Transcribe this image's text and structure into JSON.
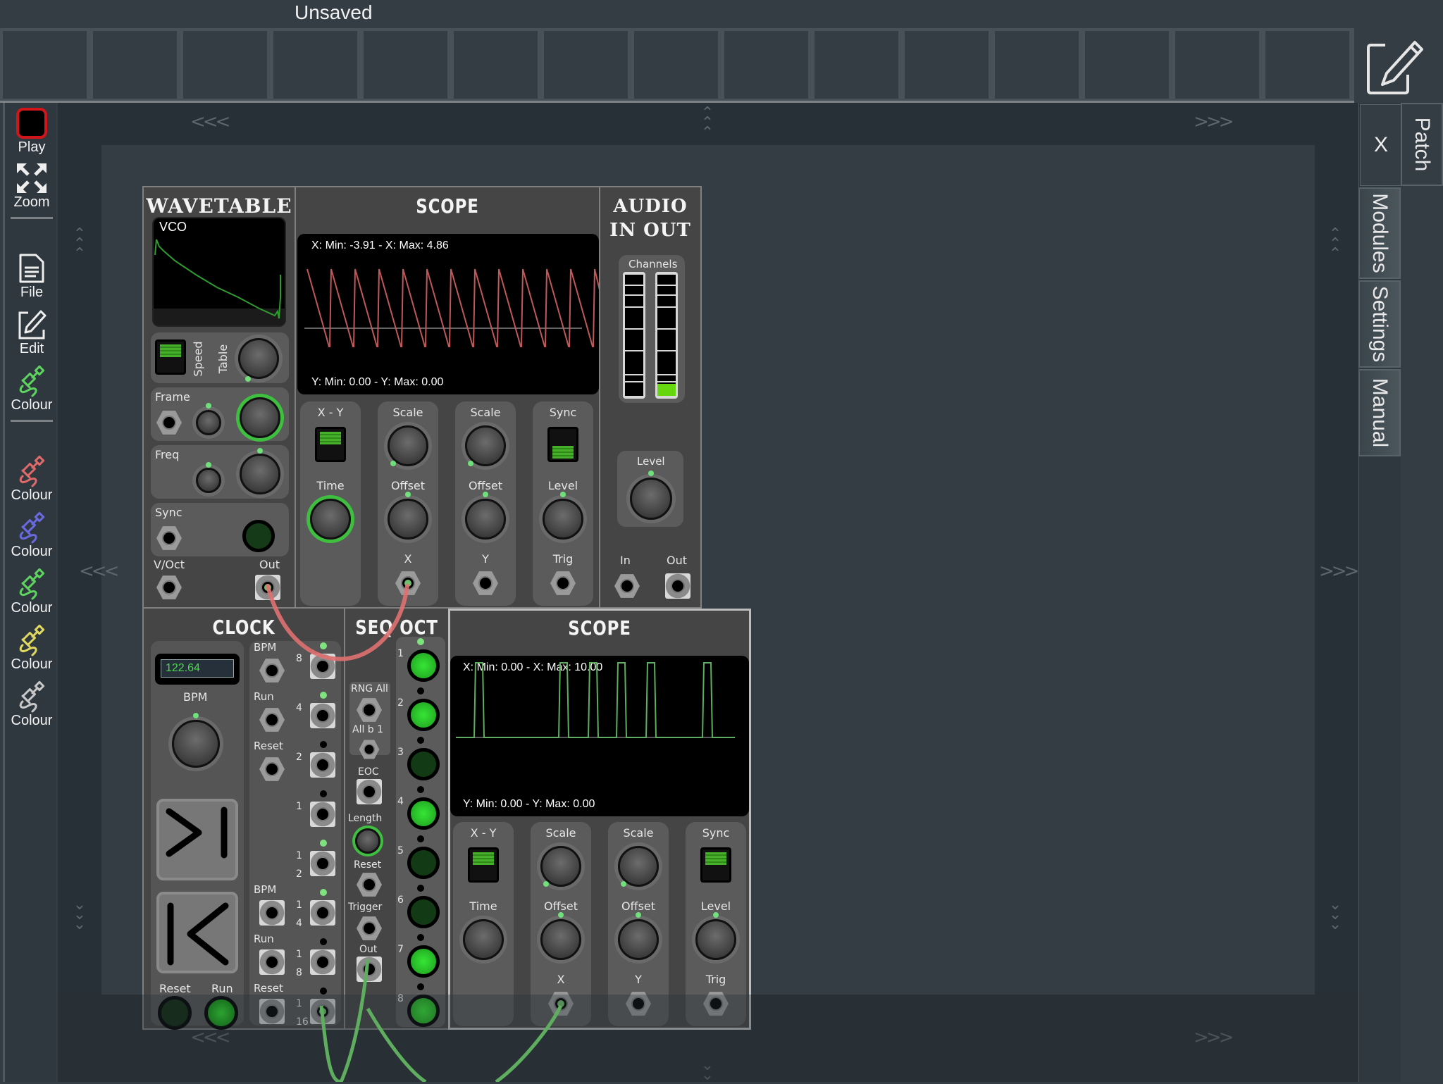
{
  "window": {
    "title": "Unsaved"
  },
  "slot_bar": {
    "slot_count": 15
  },
  "toolbar": {
    "items": [
      {
        "id": "play",
        "label": "Play",
        "icon": "stop-square-icon",
        "color": "#d0161a"
      },
      {
        "id": "zoom",
        "label": "Zoom",
        "icon": "expand-arrows-icon"
      },
      {
        "id": "file",
        "label": "File",
        "icon": "document-icon"
      },
      {
        "id": "edit",
        "label": "Edit",
        "icon": "pencil-square-icon"
      },
      {
        "id": "colour-active",
        "label": "Colour",
        "icon": "cable-plug-icon",
        "color": "#5fd35f"
      },
      {
        "id": "colour-red",
        "label": "Colour",
        "icon": "cable-plug-icon",
        "color": "#e06a6a"
      },
      {
        "id": "colour-blue",
        "label": "Colour",
        "icon": "cable-plug-icon",
        "color": "#6a6ae0"
      },
      {
        "id": "colour-green",
        "label": "Colour",
        "icon": "cable-plug-icon",
        "color": "#5fd35f"
      },
      {
        "id": "colour-yellow",
        "label": "Colour",
        "icon": "cable-plug-icon",
        "color": "#e0d85f"
      },
      {
        "id": "colour-grey",
        "label": "Colour",
        "icon": "cable-plug-icon",
        "color": "#c8c8c8"
      }
    ]
  },
  "right_panel": {
    "close_label": "X",
    "tabs": [
      {
        "label": "Patch"
      },
      {
        "label": "Modules"
      },
      {
        "label": "Settings"
      },
      {
        "label": "Manual"
      }
    ]
  },
  "canvas": {
    "arrows": {
      "left": "<<<",
      "right": ">>>",
      "up": "^^^",
      "down": "vvv"
    }
  },
  "modules": {
    "wavetable": {
      "title": "WAVETABLE",
      "screen_label": "VCO",
      "speed_label": "Speed",
      "table_label": "Table",
      "frame_label": "Frame",
      "freq_label": "Freq",
      "sync_label": "Sync",
      "voct_label": "V/Oct",
      "out_label": "Out"
    },
    "scope1": {
      "title": "SCOPE",
      "x_readout": "X: Min: -3.91 - X: Max: 4.86",
      "y_readout": "Y: Min: 0.00 - Y: Max: 0.00",
      "trace_color": "#c0585a",
      "columns": [
        {
          "top": "X - Y",
          "mid": "Time",
          "bottom": ""
        },
        {
          "top": "Scale",
          "mid": "Offset",
          "bottom": "X"
        },
        {
          "top": "Scale",
          "mid": "Offset",
          "bottom": "Y"
        },
        {
          "top": "Sync",
          "mid": "Level",
          "bottom": "Trig"
        }
      ]
    },
    "audio": {
      "title_line1": "AUDIO",
      "title_line2": "IN OUT",
      "channels_label": "Channels",
      "level_label": "Level",
      "in_label": "In",
      "out_label": "Out",
      "meter_left_level": 0.0,
      "meter_right_level": 0.1
    },
    "clock": {
      "title": "CLOCK",
      "bpm_display": "122.64",
      "bpm_label": "BPM",
      "reset_label": "Reset",
      "run_label": "Run",
      "inputs_top": [
        "BPM",
        "Run",
        "Reset"
      ],
      "inputs_bottom": [
        "BPM",
        "Run",
        "Reset"
      ],
      "divisions": [
        {
          "label": "8",
          "led": true
        },
        {
          "label": "4",
          "led": true
        },
        {
          "label": "2",
          "led": false
        },
        {
          "label": "1",
          "led": false
        },
        {
          "label": "1\n2",
          "led": true
        },
        {
          "label": "1\n4",
          "led": true
        },
        {
          "label": "1\n8",
          "led": false
        },
        {
          "label": "1\n16",
          "led": false
        }
      ]
    },
    "seqoct": {
      "title": "SEQ OCT",
      "rng_all_label": "RNG All",
      "all_b1_label": "All b 1",
      "eoc_label": "EOC",
      "length_label": "Length",
      "reset_label": "Reset",
      "trigger_label": "Trigger",
      "out_label": "Out",
      "steps": [
        {
          "label": "1",
          "on": true
        },
        {
          "label": "2",
          "on": true
        },
        {
          "label": "3",
          "on": false
        },
        {
          "label": "4",
          "on": true
        },
        {
          "label": "5",
          "on": false
        },
        {
          "label": "6",
          "on": false
        },
        {
          "label": "7",
          "on": true
        },
        {
          "label": "8",
          "on": true
        }
      ]
    },
    "scope2": {
      "title": "SCOPE",
      "x_readout": "X: Min: 0.00 - X: Max: 10.00",
      "y_readout": "Y: Min: 0.00 - Y: Max: 0.00",
      "trace_color": "#5fae5f",
      "columns": [
        {
          "top": "X - Y",
          "mid": "Time",
          "bottom": ""
        },
        {
          "top": "Scale",
          "mid": "Offset",
          "bottom": "X"
        },
        {
          "top": "Scale",
          "mid": "Offset",
          "bottom": "Y"
        },
        {
          "top": "Sync",
          "mid": "Level",
          "bottom": "Trig"
        }
      ]
    }
  },
  "cables": [
    {
      "from": "wavetable.out",
      "to": "scope1.x",
      "color": "#e07070"
    },
    {
      "from": "clock.div_1_16",
      "to": "offscreen",
      "color": "#5fae5f"
    },
    {
      "from": "seqoct.trigger",
      "to": "offscreen",
      "color": "#5fae5f"
    },
    {
      "from": "seqoct.out",
      "to": "offscreen",
      "color": "#5fae5f"
    },
    {
      "from": "scope2.x",
      "to": "offscreen",
      "color": "#5fae5f"
    }
  ]
}
